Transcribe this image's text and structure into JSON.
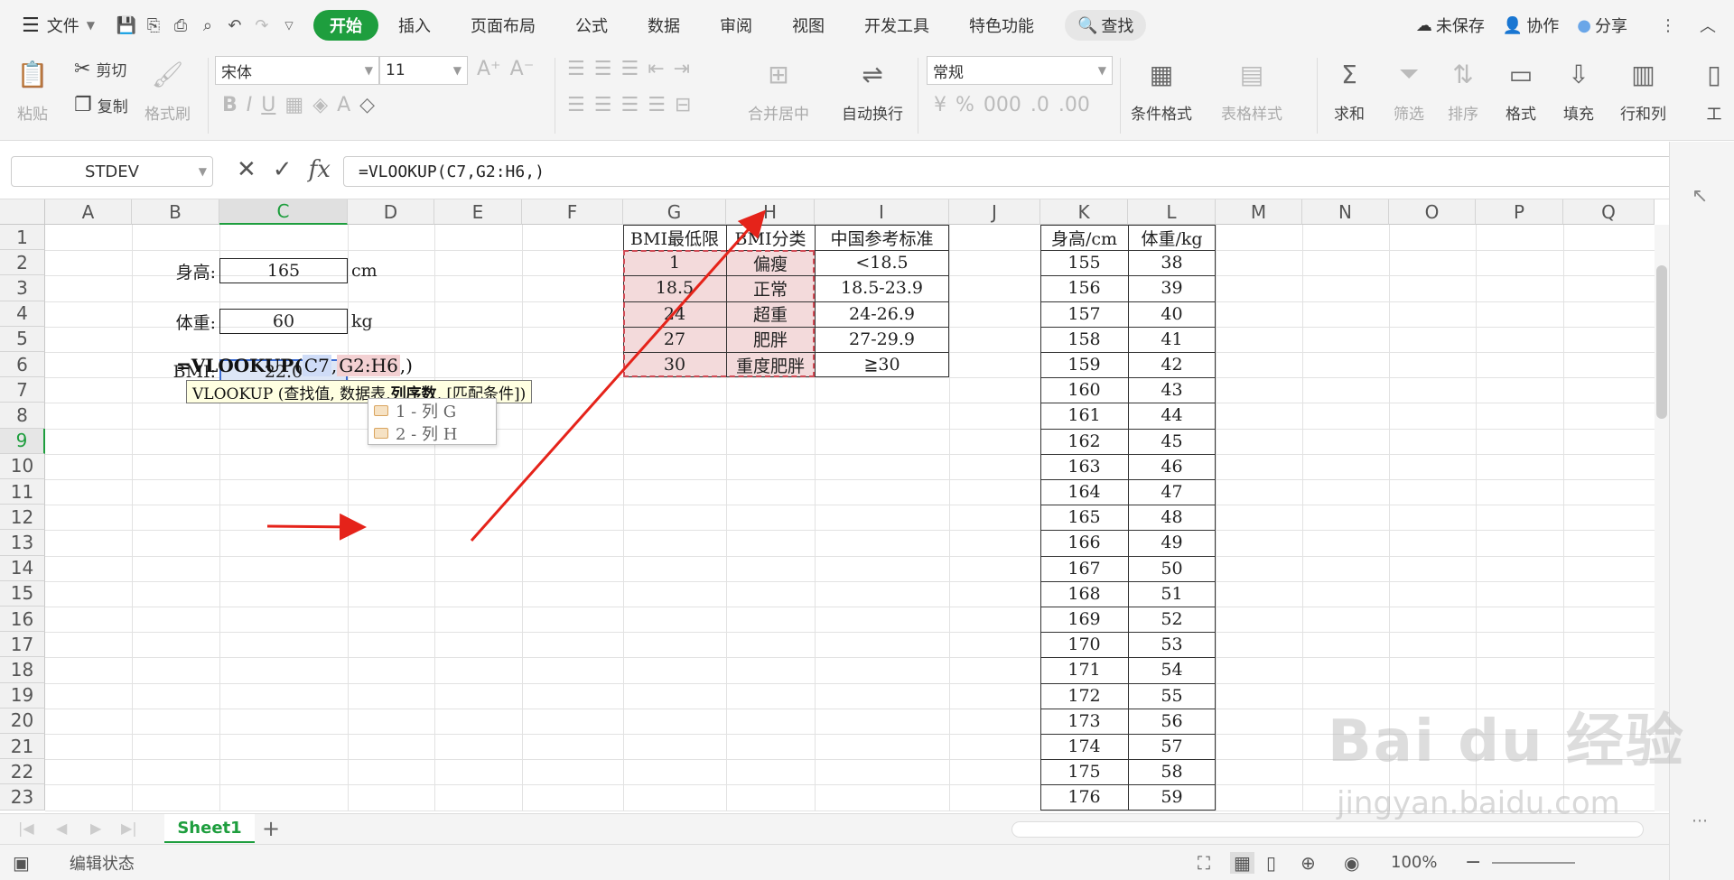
{
  "menubar": {
    "file_label": "文件",
    "tabs": [
      "开始",
      "插入",
      "页面布局",
      "公式",
      "数据",
      "审阅",
      "视图",
      "开发工具",
      "特色功能"
    ],
    "active_tab": "开始",
    "search_label": "查找",
    "unsaved_label": "未保存",
    "collab_label": "协作",
    "share_label": "分享"
  },
  "ribbon": {
    "paste": "粘贴",
    "cut": "剪切",
    "copy": "复制",
    "format_painter": "格式刷",
    "font_name": "宋体",
    "font_size": "11",
    "merge_center": "合并居中",
    "wrap_text": "自动换行",
    "number_format": "常规",
    "conditional_format": "条件格式",
    "table_style": "表格样式",
    "sum": "求和",
    "filter": "筛选",
    "sort": "排序",
    "format": "格式",
    "fill": "填充",
    "row_col": "行和列",
    "work": "工"
  },
  "formula_bar": {
    "name_box": "STDEV",
    "fx": "fx",
    "formula": "=VLOOKUP(C7,G2:H6,)"
  },
  "columns": [
    "A",
    "B",
    "C",
    "D",
    "E",
    "F",
    "G",
    "H",
    "I",
    "J",
    "K",
    "L",
    "M",
    "N",
    "O",
    "P",
    "Q"
  ],
  "rows": [
    "1",
    "2",
    "3",
    "4",
    "5",
    "6",
    "7",
    "8",
    "9",
    "10",
    "11",
    "12",
    "13",
    "14",
    "15",
    "16",
    "17",
    "18",
    "19",
    "20",
    "21",
    "22",
    "23"
  ],
  "left_form": {
    "height_label": "身高:",
    "height_value": "165",
    "height_unit": "cm",
    "weight_label": "体重:",
    "weight_value": "60",
    "weight_unit": "kg",
    "bmi_label": "BMI:",
    "bmi_value": "22.0"
  },
  "edit": {
    "prefix": "=VLOOKUP(",
    "ref1": "C7",
    "comma1": ",",
    "ref2": "G2:H6",
    "suffix": ",)",
    "tooltip_pre": "VLOOKUP (查找值, 数据表, ",
    "tooltip_bold": "列序数",
    "tooltip_post": ", [匹配条件])",
    "options": [
      "1 - 列 G",
      "2 - 列 H"
    ]
  },
  "bmi_table": {
    "headers": [
      "BMI最低限",
      "BMI分类",
      "中国参考标准"
    ],
    "rows": [
      [
        "1",
        "偏瘦",
        "<18.5"
      ],
      [
        "18.5",
        "正常",
        "18.5-23.9"
      ],
      [
        "24",
        "超重",
        "24-26.9"
      ],
      [
        "27",
        "肥胖",
        "27-29.9"
      ],
      [
        "30",
        "重度肥胖",
        "≧30"
      ]
    ]
  },
  "height_weight_table": {
    "headers": [
      "身高/cm",
      "体重/kg"
    ],
    "rows": [
      [
        "155",
        "38"
      ],
      [
        "156",
        "39"
      ],
      [
        "157",
        "40"
      ],
      [
        "158",
        "41"
      ],
      [
        "159",
        "42"
      ],
      [
        "160",
        "43"
      ],
      [
        "161",
        "44"
      ],
      [
        "162",
        "45"
      ],
      [
        "163",
        "46"
      ],
      [
        "164",
        "47"
      ],
      [
        "165",
        "48"
      ],
      [
        "166",
        "49"
      ],
      [
        "167",
        "50"
      ],
      [
        "168",
        "51"
      ],
      [
        "169",
        "52"
      ],
      [
        "170",
        "53"
      ],
      [
        "171",
        "54"
      ],
      [
        "172",
        "55"
      ],
      [
        "173",
        "56"
      ],
      [
        "174",
        "57"
      ],
      [
        "175",
        "58"
      ],
      [
        "176",
        "59"
      ]
    ]
  },
  "sheet_tab": "Sheet1",
  "status": {
    "mode": "编辑状态",
    "zoom": "100%"
  },
  "watermark": {
    "brand": "Bai du 经验",
    "url": "jingyan.baidu.com"
  },
  "colors": {
    "accent_green": "#1e9e3e",
    "ref_blue": "#cfdcf7",
    "ref_pink": "#f3d0d2",
    "arrow_red": "#e5231a"
  }
}
